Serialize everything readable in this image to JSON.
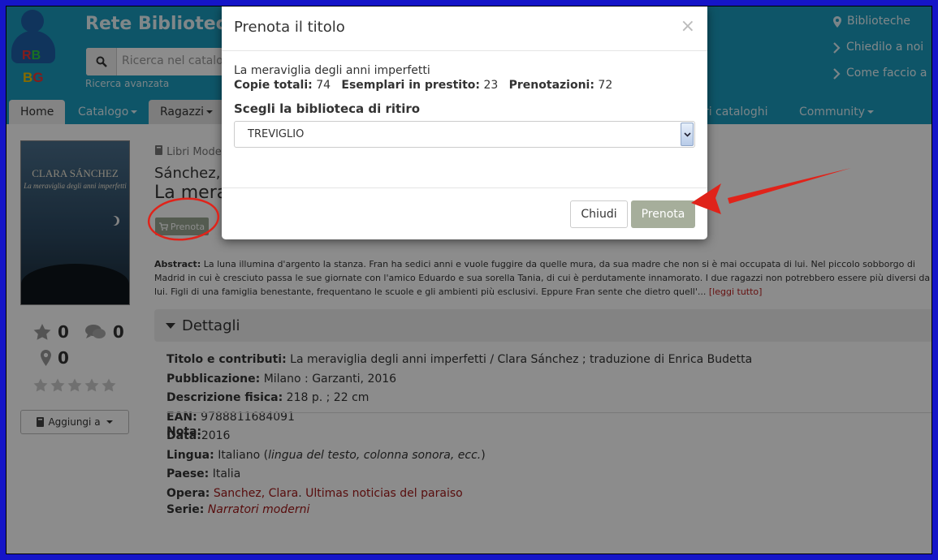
{
  "header": {
    "site_title": "Rete Bibliotecaria",
    "logo_rb": "RB",
    "logo_bg": "BG",
    "search_placeholder": "Ricerca nel catalogo",
    "advanced_search": "Ricerca avanzata",
    "top_links": [
      "Biblioteche",
      "Chiedilo a noi",
      "Come faccio a"
    ]
  },
  "nav": {
    "tabs": [
      "Home",
      "Catalogo",
      "Ragazzi",
      "Altri cataloghi",
      "Community"
    ]
  },
  "book": {
    "breadcrumb": "Libri Moderni",
    "author": "Sánchez, Clara",
    "title": "La meraviglia degli anni imperfetti",
    "cover_author": "CLARA SÁNCHEZ",
    "cover_title": "La meraviglia degli anni imperfetti",
    "prenota_label": "Prenota",
    "stars_count": "0",
    "comments_count": "0",
    "location_count": "0",
    "aggiungi_label": "Aggiungi a",
    "abstract_label": "Abstract:",
    "abstract_text": "La luna illumina d'argento la stanza. Fran ha sedici anni e vuole fuggire da quelle mura, da sua madre che non si è mai occupata di lui. Nel piccolo sobborgo di Madrid in cui è cresciuto passa le sue giornate con l'amico Eduardo e sua sorella Tania, di cui è perdutamente innamorato. I due ragazzi non potrebbero essere più diversi da lui. Figli di una famiglia benestante, frequentano le scuole e gli ambienti più esclusivi. Eppure Fran sente che dietro quell'...",
    "abstract_more": "[leggi tutto]",
    "details_heading": "Dettagli",
    "details": {
      "titolo_label": "Titolo e contributi:",
      "titolo": "La meraviglia degli anni imperfetti / Clara Sánchez ; traduzione di Enrica Budetta",
      "pubblicazione_label": "Pubblicazione:",
      "pubblicazione": "Milano : Garzanti, 2016",
      "descrizione_label": "Descrizione fisica:",
      "descrizione": "218 p. ; 22 cm",
      "ean_label": "EAN:",
      "ean": "9788811684091",
      "data_label": "Data:",
      "data": "2016",
      "lingua_label": "Lingua:",
      "lingua": "Italiano",
      "lingua_note": "lingua del testo, colonna sonora, ecc.",
      "paese_label": "Paese:",
      "paese": "Italia",
      "opera_label": "Opera:",
      "opera_author": "Sanchez, Clara",
      "opera_title": "Ultimas noticias del paraiso",
      "serie_label": "Serie:",
      "serie": "Narratori moderni",
      "nota_label": "Nota:"
    }
  },
  "modal": {
    "title": "Prenota il titolo",
    "close": "×",
    "book_title": "La meraviglia degli anni imperfetti",
    "copie_label": "Copie totali:",
    "copie": "74",
    "esemplari_label": "Esemplari in prestito:",
    "esemplari": "23",
    "prenotazioni_label": "Prenotazioni:",
    "prenotazioni": "72",
    "choose_label": "Scegli la biblioteca di ritiro",
    "selected_library": "TREVIGLIO",
    "btn_close": "Chiudi",
    "btn_reserve": "Prenota"
  },
  "colors": {
    "header_bg": "#1a9bbd",
    "annotation_red": "#e0231a",
    "link_red": "#a01818",
    "prenota_btn": "#a6ae9b"
  }
}
